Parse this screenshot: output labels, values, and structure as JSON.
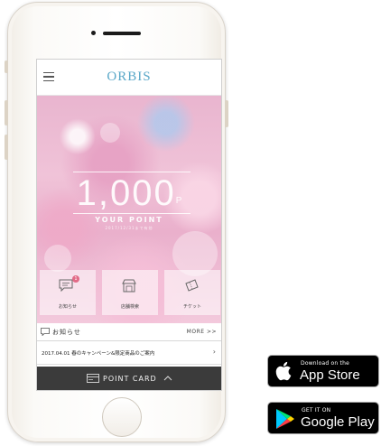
{
  "app": {
    "brand": "ORBIS",
    "points_value": "1,000",
    "points_unit": "P",
    "points_caption": "YOUR POINT",
    "points_subcaption": "2017/12/31まで有効",
    "tiles": [
      {
        "label": "お知らせ",
        "icon": "notice-icon",
        "badge": "1"
      },
      {
        "label": "店舗検索",
        "icon": "store-icon"
      },
      {
        "label": "チケット",
        "icon": "ticket-icon"
      }
    ],
    "news": {
      "title": "お知らせ",
      "more": "MORE >>",
      "items": [
        {
          "text": "2017.04.01 春のキャンペーン&限定商品のご案内"
        }
      ]
    },
    "point_card_label": "POINT CARD",
    "colors": {
      "brand": "#5aa8c8",
      "bar": "#3b3b3b",
      "badge": "#e26b87"
    }
  },
  "stores": {
    "apple": {
      "small": "Download on the",
      "big": "App Store"
    },
    "google": {
      "small": "GET IT ON",
      "big": "Google Play"
    }
  }
}
